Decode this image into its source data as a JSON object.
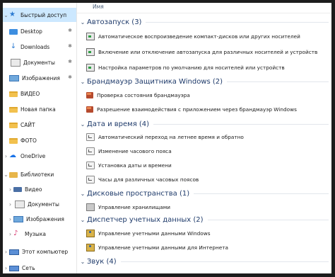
{
  "sidebar": {
    "items": [
      {
        "label": "Быстрый доступ",
        "icon": "star-icon",
        "chevron": "⌄",
        "pinned": false
      },
      {
        "label": "Desktop",
        "icon": "desktop-icon",
        "chevron": "",
        "pinned": true
      },
      {
        "label": "Downloads",
        "icon": "download-icon",
        "chevron": "",
        "pinned": true
      },
      {
        "label": "Документы",
        "icon": "document-icon",
        "chevron": "",
        "pinned": true
      },
      {
        "label": "Изображения",
        "icon": "pictures-icon",
        "chevron": "",
        "pinned": true
      },
      {
        "label": "ВИДЕО",
        "icon": "folder-icon",
        "chevron": "",
        "pinned": false
      },
      {
        "label": "Новая папка",
        "icon": "folder-icon",
        "chevron": "",
        "pinned": false
      },
      {
        "label": "САЙТ",
        "icon": "folder-icon",
        "chevron": "",
        "pinned": false
      },
      {
        "label": "ФОТО",
        "icon": "folder-icon",
        "chevron": "",
        "pinned": false
      },
      {
        "label": "OneDrive",
        "icon": "cloud-icon",
        "chevron": "›",
        "pinned": false
      },
      {
        "label": "Библиотеки",
        "icon": "libraries-icon",
        "chevron": "⌄",
        "pinned": false
      },
      {
        "label": "Видео",
        "icon": "video-icon",
        "chevron": "›",
        "pinned": false
      },
      {
        "label": "Документы",
        "icon": "document-icon",
        "chevron": "›",
        "pinned": false
      },
      {
        "label": "Изображения",
        "icon": "pictures-icon",
        "chevron": "›",
        "pinned": false
      },
      {
        "label": "Музыка",
        "icon": "music-icon",
        "chevron": "›",
        "pinned": false
      },
      {
        "label": "Этот компьютер",
        "icon": "computer-icon",
        "chevron": "›",
        "pinned": false
      },
      {
        "label": "Сеть",
        "icon": "network-icon",
        "chevron": "›",
        "pinned": false
      }
    ],
    "pin_glyph": "✱"
  },
  "main": {
    "column_header": "Имя",
    "groups": [
      {
        "title": "Автозапуск (3)",
        "chevron": "⌄",
        "items": [
          "Автоматическое воспроизведение компакт-дисков или других носителей",
          "Включение или отключение автозапуска для различных носителей и устройств",
          "Настройка параметров по умолчанию для носителей или устройств"
        ]
      },
      {
        "title": "Брандмауэр Защитника Windows (2)",
        "chevron": "⌄",
        "items": [
          "Проверка состояния брандмауэра",
          "Разрешение взаимодействия с приложением через брандмауэр Windows"
        ]
      },
      {
        "title": "Дата и время (4)",
        "chevron": "⌄",
        "items": [
          "Автоматический переход на летнее время и обратно",
          "Изменение часового пояса",
          "Установка даты и времени",
          "Часы для различных часовых поясов"
        ]
      },
      {
        "title": "Дисковые пространства (1)",
        "chevron": "⌄",
        "items": [
          "Управление хранилищами"
        ]
      },
      {
        "title": "Диспетчер учетных данных (2)",
        "chevron": "⌄",
        "items": [
          "Управление учетными данными Windows",
          "Управление учетными данными для Интернета"
        ]
      },
      {
        "title": "Звук (4)",
        "chevron": "⌄",
        "items": []
      }
    ]
  }
}
